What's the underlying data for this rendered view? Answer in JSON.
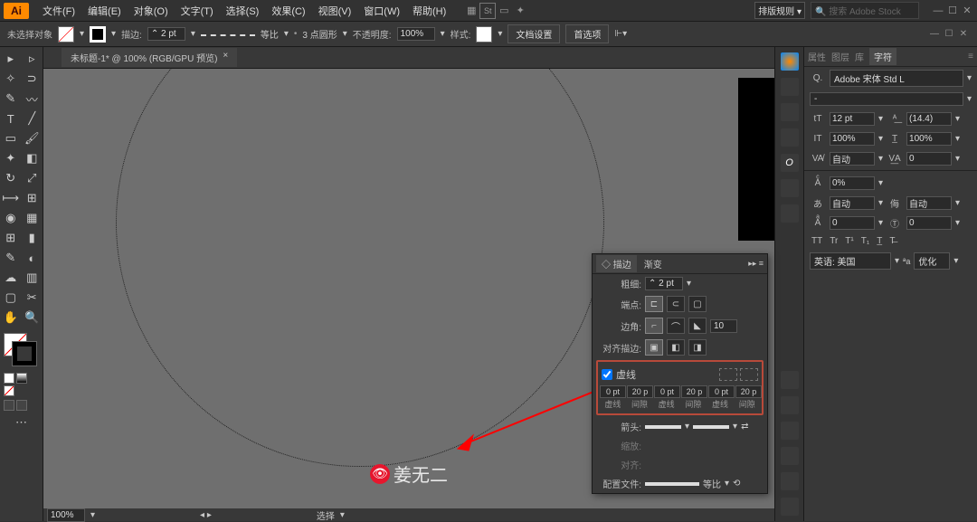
{
  "menu": {
    "items": [
      "文件(F)",
      "编辑(E)",
      "对象(O)",
      "文字(T)",
      "选择(S)",
      "效果(C)",
      "视图(V)",
      "窗口(W)",
      "帮助(H)"
    ],
    "layout_label": "排版规则",
    "search_placeholder": "搜索 Adobe Stock"
  },
  "controlbar": {
    "no_selection": "未选择对象",
    "stroke_label": "描边:",
    "stroke_weight": "2 pt",
    "stroke_style": "等比",
    "brush_label": "3 点圆形",
    "opacity_label": "不透明度:",
    "opacity_value": "100%",
    "style_label": "样式:",
    "doc_setup": "文档设置",
    "prefs": "首选项"
  },
  "doc_tab": {
    "title": "未标题-1* @ 100% (RGB/GPU 预览)",
    "close": "×"
  },
  "stroke_panel": {
    "tabs": [
      "描边",
      "渐变"
    ],
    "weight_label": "粗细:",
    "weight_value": "2 pt",
    "cap_label": "端点:",
    "corner_label": "边角:",
    "limit_value": "10",
    "align_label": "对齐描边:",
    "dash_label": "虚线",
    "dash_values": [
      "0 pt",
      "20 p",
      "0 pt",
      "20 p",
      "0 pt",
      "20 p"
    ],
    "dash_sublabels": [
      "虚线",
      "间隙",
      "虚线",
      "间隙",
      "虚线",
      "间隙"
    ],
    "arrow_label": "箭头:",
    "scale_label": "缩放:",
    "align2_label": "对齐:",
    "profile_label": "配置文件:",
    "profile_value": "等比"
  },
  "char_panel": {
    "tabs": [
      "属性",
      "图层",
      "库",
      "字符"
    ],
    "font": "Adobe 宋体 Std L",
    "style": "-",
    "size": "12 pt",
    "leading": "(14.4)",
    "vscale": "100%",
    "hscale": "100%",
    "kerning": "自动",
    "tracking": "0",
    "baseline": "0%",
    "opt_auto": "自动",
    "opt_zero1": "0",
    "opt_zero2": "0",
    "lang": "英语: 美国",
    "aa_label": "优化"
  },
  "footer": {
    "zoom": "100%",
    "select_label": "选择"
  },
  "watermark": "姜无二"
}
